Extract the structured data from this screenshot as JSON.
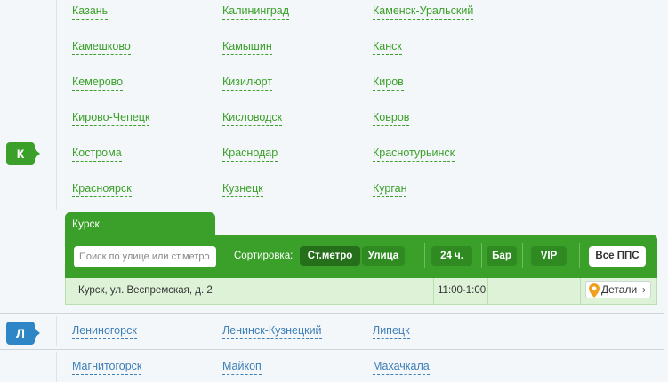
{
  "letters": {
    "k": "К",
    "l": "Л"
  },
  "cities_k": [
    [
      "Казань",
      "Калининград",
      "Каменск-Уральский"
    ],
    [
      "Камешково",
      "Камышин",
      "Канск"
    ],
    [
      "Кемерово",
      "Кизилюрт",
      "Киров"
    ],
    [
      "Кирово-Чепецк",
      "Кисловодск",
      "Ковров"
    ],
    [
      "Кострома",
      "Краснодар",
      "Краснотурьинск"
    ],
    [
      "Красноярск",
      "Кузнецк",
      "Курган"
    ]
  ],
  "panel": {
    "city": "Курск",
    "search_placeholder": "Поиск по улице или ст.метро",
    "sort_label": "Сортировка:",
    "sort_metro": "Ст.метро",
    "sort_street": "Улица",
    "filter_24h": "24 ч.",
    "filter_bar": "Бар",
    "filter_vip": "VIP",
    "all_button": "Все ППС",
    "row": {
      "address": "Курск, ул. Веспремская, д. 2",
      "hours": "11:00-1:00",
      "details": "Детали"
    }
  },
  "cities_l": [
    [
      "Лениногорск",
      "Ленинск-Кузнецкий",
      "Липецк"
    ]
  ],
  "cities_m": [
    [
      "Магнитогорск",
      "Майкоп",
      "Махачкала"
    ]
  ],
  "colors": {
    "green": "#3aa02a",
    "blue": "#2f86c6",
    "link_blue": "#3d7fb8"
  }
}
